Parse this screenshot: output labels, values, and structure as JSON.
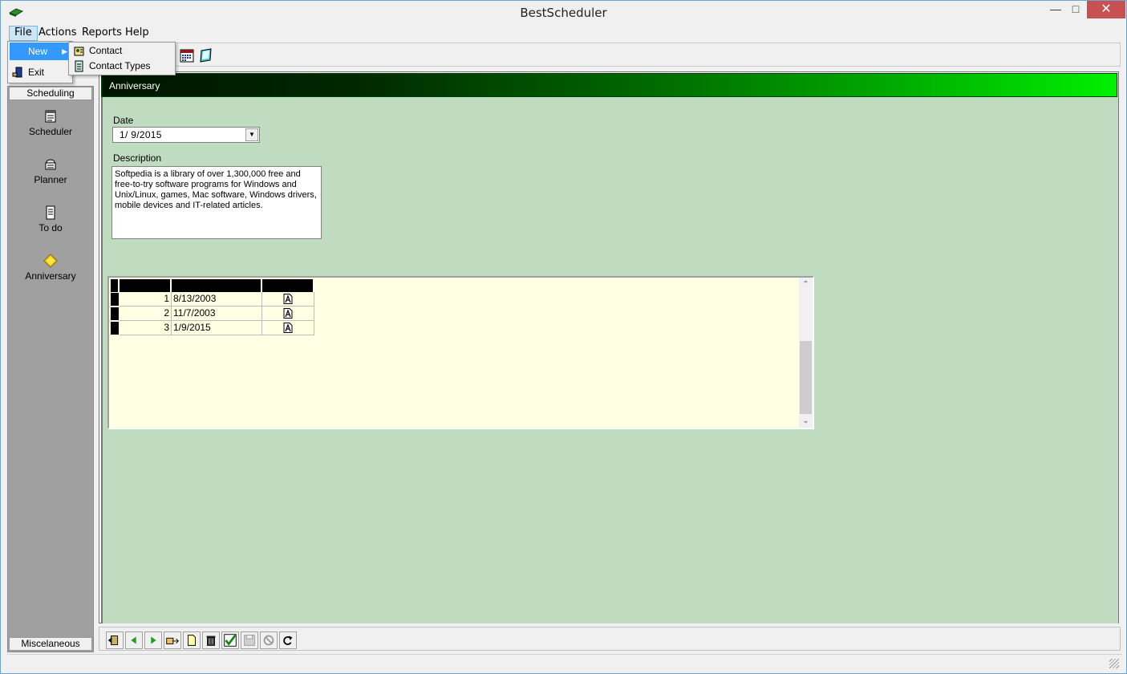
{
  "window": {
    "title": "BestScheduler"
  },
  "menubar": {
    "items": [
      "File",
      "Actions",
      "Reports",
      "Help"
    ]
  },
  "file_menu": {
    "new_label": "New",
    "exit_label": "Exit",
    "submenu": [
      "Contact",
      "Contact Types"
    ]
  },
  "sidebar": {
    "header": "Scheduling",
    "footer": "Miscelaneous",
    "items": [
      {
        "label": "Scheduler",
        "icon": "scheduler-icon"
      },
      {
        "label": "Planner",
        "icon": "planner-icon"
      },
      {
        "label": "To do",
        "icon": "todo-icon"
      },
      {
        "label": "Anniversary",
        "icon": "anniversary-icon"
      }
    ]
  },
  "panel": {
    "title": "Anniversary",
    "date_label": "Date",
    "date_value": "1/  9/2015",
    "description_label": "Description",
    "description_value": "Softpedia is a library of over 1,300,000 free and free-to-try software programs for Windows and Unix/Linux, games, Mac software, Windows drivers, mobile devices and IT-related articles."
  },
  "grid": {
    "rows": [
      {
        "num": "1",
        "date": "8/13/2003"
      },
      {
        "num": "2",
        "date": "11/7/2003"
      },
      {
        "num": "3",
        "date": "1/9/2015"
      }
    ]
  },
  "colors": {
    "content_bg": "#c0dcc0",
    "grid_bg": "#ffffe4",
    "header_gradient_start": "#001400",
    "header_gradient_end": "#00f000",
    "menu_highlight": "#3399ff"
  }
}
